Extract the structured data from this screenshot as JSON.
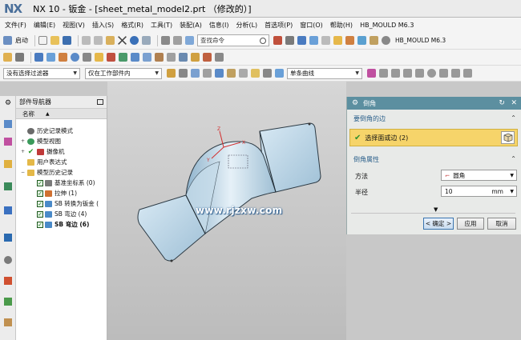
{
  "window": {
    "logo": "NX",
    "title": "NX 10 - 钣金 - [sheet_metal_model2.prt （修改的）]"
  },
  "menu": [
    "文件(F)",
    "编辑(E)",
    "视图(V)",
    "插入(S)",
    "格式(R)",
    "工具(T)",
    "装配(A)",
    "信息(I)",
    "分析(L)",
    "首选项(P)",
    "窗口(O)",
    "帮助(H)",
    "HB_MOULD M6.3"
  ],
  "toolbar": {
    "start_label": "启动",
    "search_placeholder": "查找命令",
    "filter_value": "没有选择过滤器",
    "scope_value": "仅在工作部件内",
    "curve_rule_value": "单条曲线"
  },
  "navigator": {
    "title": "部件导航器",
    "column_name": "名称",
    "items": [
      {
        "label": "历史记录模式",
        "indent": 1,
        "bold": false
      },
      {
        "label": "模型视图",
        "indent": 1,
        "bold": false
      },
      {
        "label": "摄像机",
        "indent": 1,
        "bold": false
      },
      {
        "label": "用户表达式",
        "indent": 1,
        "bold": false
      },
      {
        "label": "模型历史记录",
        "indent": 1,
        "bold": false
      },
      {
        "label": "基准坐标系 (0)",
        "indent": 2,
        "bold": false
      },
      {
        "label": "拉伸 (1)",
        "indent": 2,
        "bold": false
      },
      {
        "label": "SB 转换为钣金 (",
        "indent": 2,
        "bold": false
      },
      {
        "label": "SB 弯边 (4)",
        "indent": 2,
        "bold": false
      },
      {
        "label": "SB 弯边 (6)",
        "indent": 2,
        "bold": true
      }
    ]
  },
  "viewport": {
    "watermark": "www.rjzxw.com"
  },
  "dialog": {
    "title": "倒角",
    "section1": "要倒角的边",
    "select_label": "选择面或边 (2)",
    "section2": "倒角属性",
    "method_label": "方法",
    "method_value": "圆角",
    "radius_label": "半径",
    "radius_value": "10",
    "radius_unit": "mm",
    "ok": "< 确定 >",
    "apply": "应用",
    "cancel": "取消"
  },
  "colors": {
    "accent": "#5c8fa0",
    "highlight": "#f6d46a",
    "part": "#b9d4e4"
  }
}
